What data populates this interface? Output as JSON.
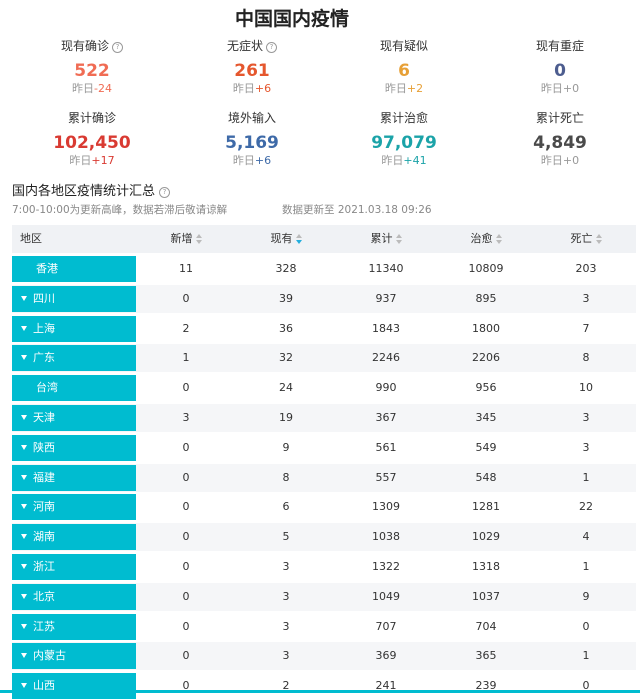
{
  "title": "中国国内疫情",
  "stats": [
    {
      "label": "现有确诊",
      "help": true,
      "value": "522",
      "cmp_label": "昨日",
      "cmp_value": "-24",
      "color": "#f06c54",
      "cmp_color": "#f06c54"
    },
    {
      "label": "无症状",
      "help": true,
      "value": "261",
      "cmp_label": "昨日",
      "cmp_value": "+6",
      "color": "#e5572e",
      "cmp_color": "#e5572e"
    },
    {
      "label": "现有疑似",
      "help": false,
      "value": "6",
      "cmp_label": "昨日",
      "cmp_value": "+2",
      "color": "#e7a036",
      "cmp_color": "#e7a036"
    },
    {
      "label": "现有重症",
      "help": false,
      "value": "0",
      "cmp_label": "昨日",
      "cmp_value": "+0",
      "color": "#4d5d8f",
      "cmp_color": "#999999"
    },
    {
      "label": "累计确诊",
      "help": false,
      "value": "102,450",
      "cmp_label": "昨日",
      "cmp_value": "+17",
      "color": "#d93a32",
      "cmp_color": "#d93a32"
    },
    {
      "label": "境外输入",
      "help": false,
      "value": "5,169",
      "cmp_label": "昨日",
      "cmp_value": "+6",
      "color": "#3e6aa8",
      "cmp_color": "#3e6aa8"
    },
    {
      "label": "累计治愈",
      "help": false,
      "value": "97,079",
      "cmp_label": "昨日",
      "cmp_value": "+41",
      "color": "#1ba3a8",
      "cmp_color": "#1ba3a8"
    },
    {
      "label": "累计死亡",
      "help": false,
      "value": "4,849",
      "cmp_label": "昨日",
      "cmp_value": "+0",
      "color": "#4a4a4a",
      "cmp_color": "#999999"
    }
  ],
  "section": {
    "title": "国内各地区疫情统计汇总",
    "note": "7:00-10:00为更新高峰，数据若滞后敬请谅解",
    "updated": "数据更新至 2021.03.18 09:26"
  },
  "table": {
    "headers": [
      "地区",
      "新增",
      "现有",
      "累计",
      "治愈",
      "死亡"
    ],
    "rows": [
      {
        "region": "香港",
        "expand": false,
        "cells": [
          "11",
          "328",
          "11340",
          "10809",
          "203"
        ]
      },
      {
        "region": "四川",
        "expand": true,
        "cells": [
          "0",
          "39",
          "937",
          "895",
          "3"
        ]
      },
      {
        "region": "上海",
        "expand": true,
        "cells": [
          "2",
          "36",
          "1843",
          "1800",
          "7"
        ]
      },
      {
        "region": "广东",
        "expand": true,
        "cells": [
          "1",
          "32",
          "2246",
          "2206",
          "8"
        ]
      },
      {
        "region": "台湾",
        "expand": false,
        "cells": [
          "0",
          "24",
          "990",
          "956",
          "10"
        ]
      },
      {
        "region": "天津",
        "expand": true,
        "cells": [
          "3",
          "19",
          "367",
          "345",
          "3"
        ]
      },
      {
        "region": "陕西",
        "expand": true,
        "cells": [
          "0",
          "9",
          "561",
          "549",
          "3"
        ]
      },
      {
        "region": "福建",
        "expand": true,
        "cells": [
          "0",
          "8",
          "557",
          "548",
          "1"
        ]
      },
      {
        "region": "河南",
        "expand": true,
        "cells": [
          "0",
          "6",
          "1309",
          "1281",
          "22"
        ]
      },
      {
        "region": "湖南",
        "expand": true,
        "cells": [
          "0",
          "5",
          "1038",
          "1029",
          "4"
        ]
      },
      {
        "region": "浙江",
        "expand": true,
        "cells": [
          "0",
          "3",
          "1322",
          "1318",
          "1"
        ]
      },
      {
        "region": "北京",
        "expand": true,
        "cells": [
          "0",
          "3",
          "1049",
          "1037",
          "9"
        ]
      },
      {
        "region": "江苏",
        "expand": true,
        "cells": [
          "0",
          "3",
          "707",
          "704",
          "0"
        ]
      },
      {
        "region": "内蒙古",
        "expand": true,
        "cells": [
          "0",
          "3",
          "369",
          "365",
          "1"
        ]
      },
      {
        "region": "山西",
        "expand": true,
        "cells": [
          "0",
          "2",
          "241",
          "239",
          "0"
        ]
      }
    ]
  }
}
